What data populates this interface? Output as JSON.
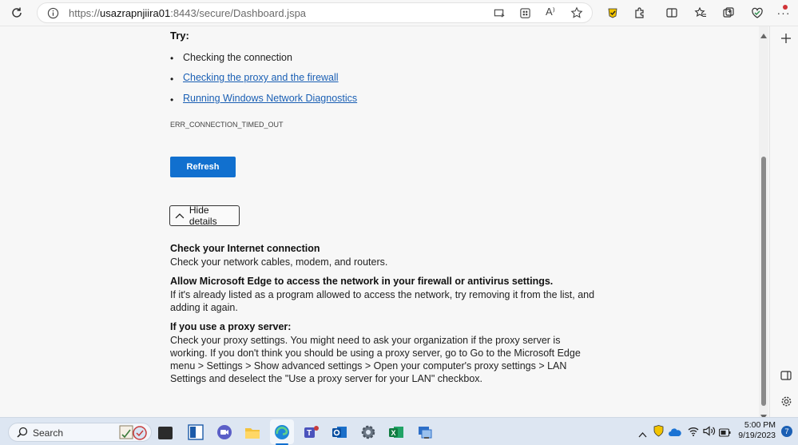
{
  "browser": {
    "url_prefix": "https://",
    "url_host": "usazrapnjiira01",
    "url_rest": ":8443/secure/Dashboard.jspa",
    "read_aloud": "A⁾"
  },
  "error": {
    "try_heading": "Try:",
    "suggestions": [
      "Checking the connection",
      "Checking the proxy and the firewall",
      "Running Windows Network Diagnostics"
    ],
    "error_code": "ERR_CONNECTION_TIMED_OUT",
    "refresh_label": "Refresh",
    "hide_details_label": "Hide details"
  },
  "details": {
    "section1_title": "Check your Internet connection",
    "section1_text": "Check your network cables, modem, and routers.",
    "section2_title": "Allow Microsoft Edge to access the network in your firewall or antivirus settings.",
    "section2_line1": "If it's already listed as a program allowed to access the network, try removing it from the list, and",
    "section2_line2": "adding it again.",
    "section3_title": "If you use a proxy server:",
    "section3_line1": "Check your proxy settings. You might need to ask your organization if the proxy server is",
    "section3_line2": "working. If you don't think you should be using a proxy server, go to Go to the Microsoft Edge",
    "section3_line3": "menu > Settings > Show advanced settings > Open your computer's proxy settings > LAN",
    "section3_line4": "Settings and deselect the \"Use a proxy server for your LAN\" checkbox."
  },
  "taskbar": {
    "search_label": "Search",
    "time": "5:00 PM",
    "date": "9/19/2023",
    "notification_count": "7"
  },
  "colors": {
    "accent": "#1170cf",
    "link": "#1a5fb4",
    "taskbar_bg": "#dde6f2"
  }
}
